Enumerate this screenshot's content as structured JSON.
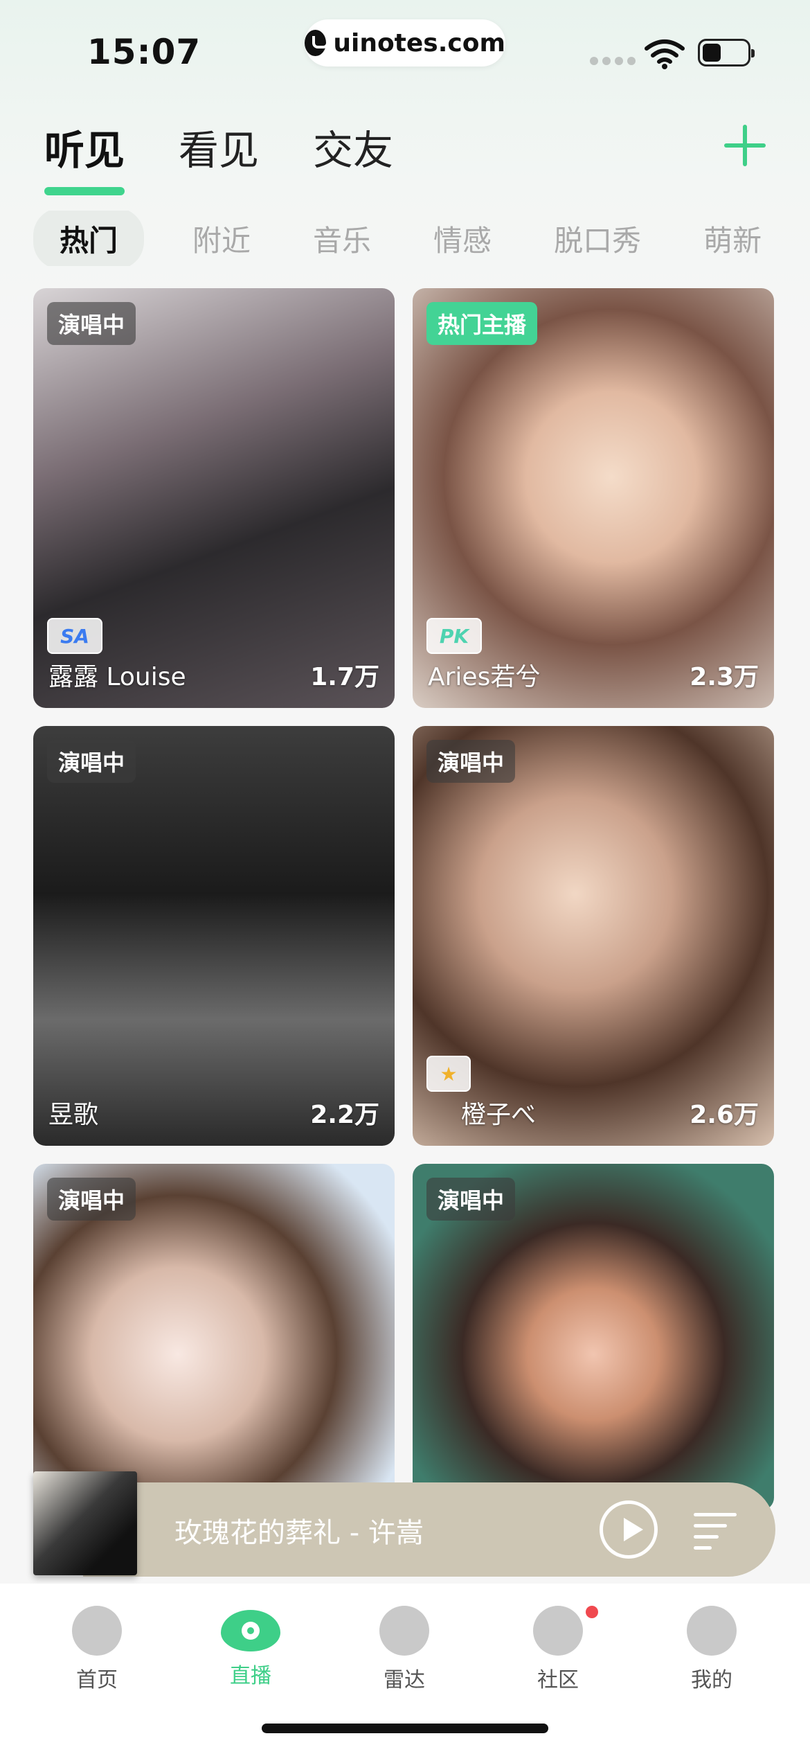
{
  "status_bar": {
    "time": "15:07",
    "url": "uinotes.com"
  },
  "main_tabs": [
    {
      "label": "听见",
      "active": true
    },
    {
      "label": "看见",
      "active": false
    },
    {
      "label": "交友",
      "active": false
    }
  ],
  "categories": [
    {
      "label": "热门",
      "active": true
    },
    {
      "label": "附近"
    },
    {
      "label": "音乐"
    },
    {
      "label": "情感"
    },
    {
      "label": "脱口秀"
    },
    {
      "label": "萌新"
    }
  ],
  "cards": [
    {
      "badge": "演唱中",
      "name": "露露 Louise",
      "viewers": "1.7万",
      "icon": "sa-icon"
    },
    {
      "badge": "热门主播",
      "name": "Aries若兮",
      "viewers": "2.3万",
      "icon": "pk-icon"
    },
    {
      "badge": "演唱中",
      "name": "昱歌",
      "viewers": "2.2万"
    },
    {
      "badge": "演唱中",
      "name": "橙子べ",
      "viewers": "2.6万",
      "icon": "medal-icon"
    },
    {
      "badge": "演唱中",
      "name": "",
      "viewers": ""
    },
    {
      "badge": "演唱中",
      "name": "",
      "viewers": ""
    }
  ],
  "player": {
    "song": "玫瑰花的葬礼 - 许嵩"
  },
  "bottom_nav": [
    {
      "label": "首页",
      "icon": "home-music-icon"
    },
    {
      "label": "直播",
      "icon": "live-eye-icon",
      "active": true
    },
    {
      "label": "雷达",
      "icon": "radar-icon"
    },
    {
      "label": "社区",
      "icon": "community-icon"
    },
    {
      "label": "我的",
      "icon": "profile-icon"
    }
  ],
  "colors": {
    "accent": "#3ecf88",
    "hot_badge": "#43d395",
    "player_bg": "#cdc6b4",
    "notification_dot": "#f0494f"
  }
}
